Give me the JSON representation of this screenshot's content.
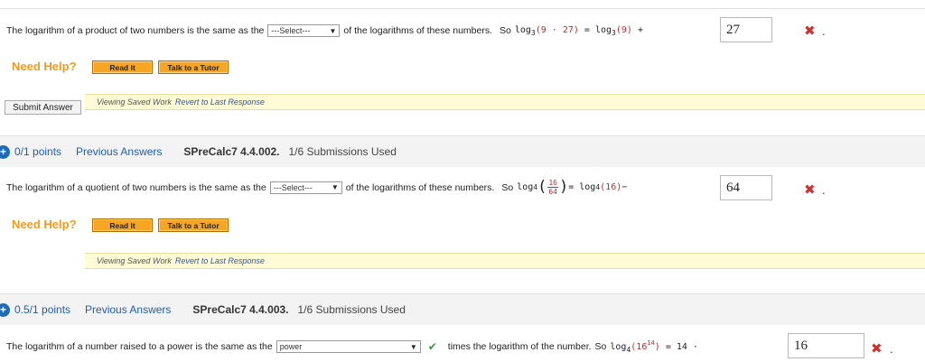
{
  "q1": {
    "text_before": "The logarithm of a product of two numbers is the same as the",
    "select_value": "---Select---",
    "text_after": "of the logarithms of these numbers.",
    "formula_so": "So",
    "formula_log": "log",
    "formula_base": "3",
    "formula_arg": "(9 · 27)",
    "formula_eq": " = log",
    "formula_base2": "3",
    "formula_arg2": "(9)",
    "formula_op": " + ",
    "answer": "27",
    "period": "."
  },
  "help1": {
    "label": "Need Help?",
    "read_it": "Read It",
    "talk": "Talk to a Tutor"
  },
  "submit": {
    "label": "Submit Answer"
  },
  "saved1": {
    "text": "Viewing Saved Work",
    "link": "Revert to Last Response"
  },
  "h2": {
    "points": "0/1 points",
    "prev": "Previous Answers",
    "code": "SPreCalc7 4.4.002.",
    "subs": "1/6 Submissions Used"
  },
  "q2": {
    "text_before": "The logarithm of a quotient of two numbers is the same as the",
    "select_value": "---Select---",
    "text_after": "of the logarithms of these numbers.",
    "formula_so": "So",
    "formula_log": "log",
    "formula_base": "4",
    "frac_num": "16",
    "frac_den": "64",
    "formula_eq": " = log",
    "formula_base2": "4",
    "formula_arg2": "(16)",
    "formula_op": " − ",
    "answer": "64",
    "period": "."
  },
  "help2": {
    "label": "Need Help?",
    "read_it": "Read It",
    "talk": "Talk to a Tutor"
  },
  "saved2": {
    "text": "Viewing Saved Work",
    "link": "Revert to Last Response"
  },
  "h3": {
    "points": "0.5/1 points",
    "prev": "Previous Answers",
    "code": "SPreCalc7 4.4.003.",
    "subs": "1/6 Submissions Used"
  },
  "q3": {
    "text_before": "The logarithm of a number raised to a power is the same as the",
    "select_value": "power",
    "text_after": "times the logarithm of the number.",
    "formula_so": "So",
    "formula_log": "log",
    "formula_base": "4",
    "formula_arg_open": "(16",
    "formula_exp": "14",
    "formula_arg_close": ")",
    "formula_eq": " = 14 · ",
    "answer": "16",
    "period": "."
  },
  "icons": {
    "incorrect": "x-icon",
    "correct": "check-icon",
    "expand": "plus-circle-icon",
    "dropdown": "triangle-down-icon"
  },
  "colors": {
    "accent_blue": "#1e6bb8",
    "help_orange": "#f39a1e",
    "incorrect_red": "#d32f2f",
    "correct_green": "#2e9b3a",
    "saved_yellow": "#fffbd6"
  }
}
